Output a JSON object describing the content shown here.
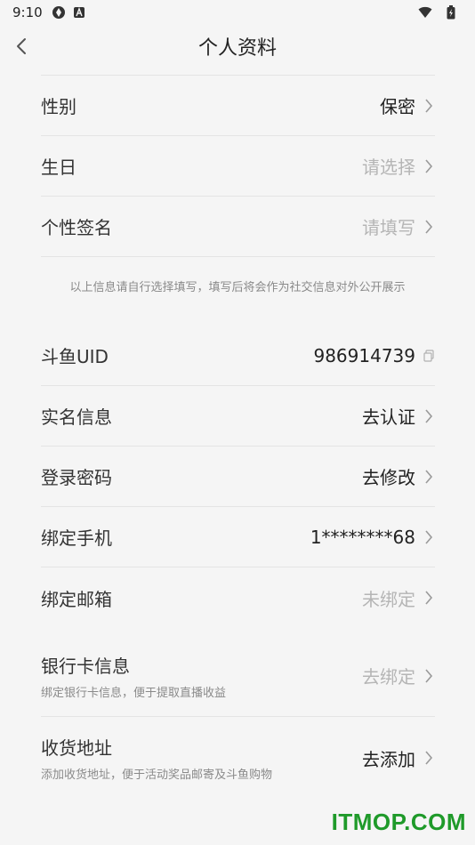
{
  "status_bar": {
    "time": "9:10"
  },
  "header": {
    "title": "个人资料"
  },
  "profile_section": {
    "gender": {
      "label": "性别",
      "value": "保密"
    },
    "birthday": {
      "label": "生日",
      "value": "请选择"
    },
    "signature": {
      "label": "个性签名",
      "value": "请填写"
    }
  },
  "hint": "以上信息请自行选择填写，填写后将会作为社交信息对外公开展示",
  "account_section": {
    "uid": {
      "label": "斗鱼UID",
      "value": "986914739"
    },
    "real_name": {
      "label": "实名信息",
      "value": "去认证"
    },
    "password": {
      "label": "登录密码",
      "value": "去修改"
    },
    "phone": {
      "label": "绑定手机",
      "value": "1********68"
    },
    "email": {
      "label": "绑定邮箱",
      "value": "未绑定"
    }
  },
  "extra_section": {
    "bank_card": {
      "label": "银行卡信息",
      "sub": "绑定银行卡信息，便于提取直播收益",
      "value": "去绑定"
    },
    "address": {
      "label": "收货地址",
      "sub": "添加收货地址，便于活动奖品邮寄及斗鱼购物",
      "value": "去添加"
    }
  },
  "watermark": "ITMOP.COM"
}
